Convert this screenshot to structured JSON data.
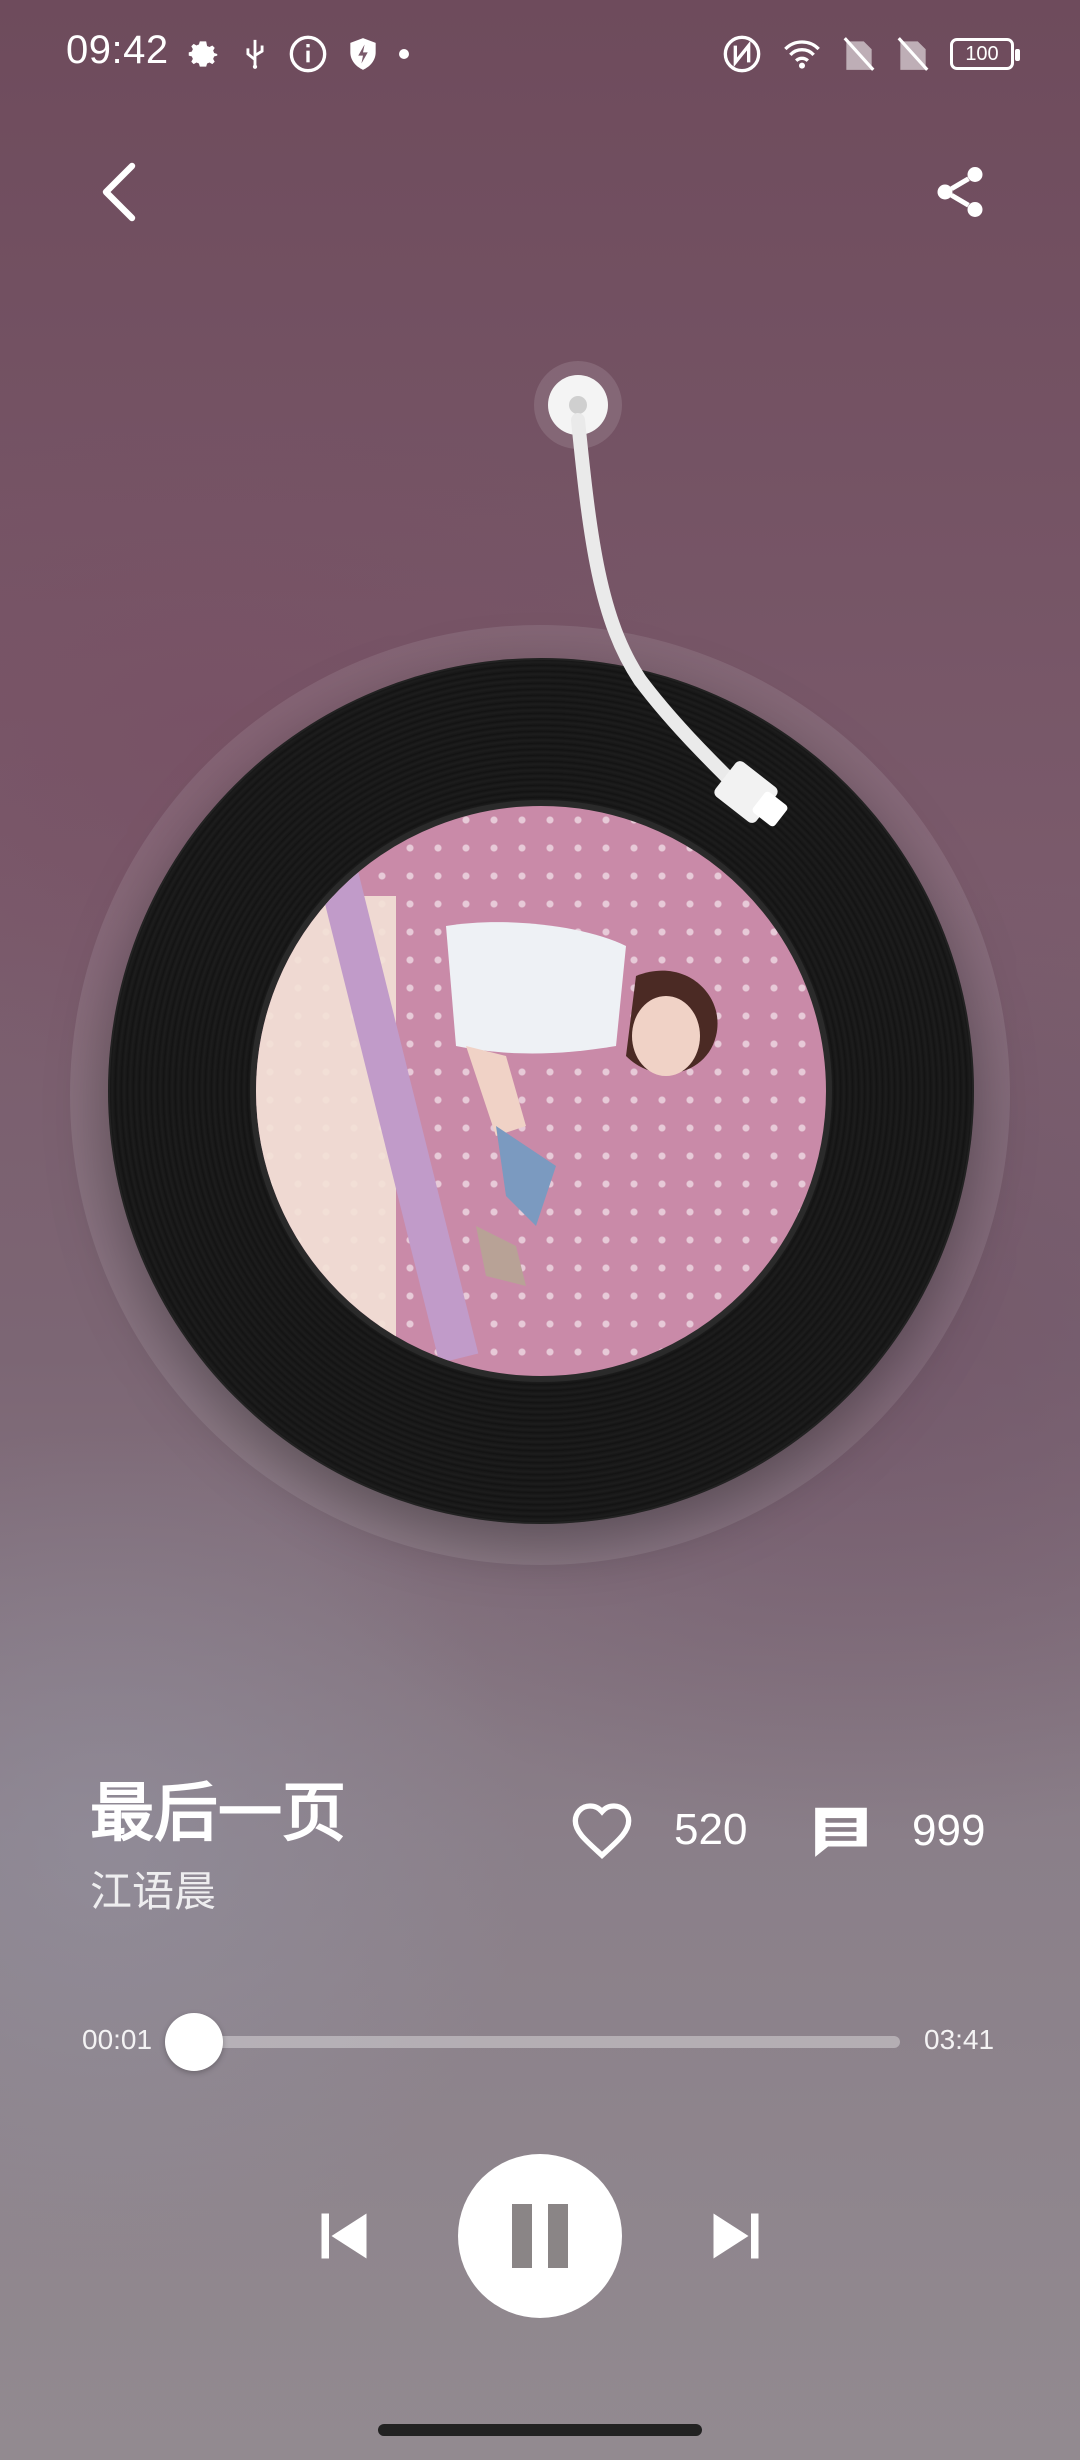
{
  "status_bar": {
    "time": "09:42",
    "battery": "100",
    "left_icons": [
      "settings-icon",
      "usb-icon",
      "info-icon",
      "shield-bolt-icon",
      "dot-icon"
    ],
    "right_icons": [
      "nfc-icon",
      "wifi-icon",
      "no-sim-icon",
      "no-sim-icon",
      "battery-icon"
    ]
  },
  "header": {
    "back_icon": "chevron-left-icon",
    "share_icon": "share-icon"
  },
  "song": {
    "title": "最后一页",
    "artist": "江语晨"
  },
  "stats": {
    "likes": "520",
    "comments": "999"
  },
  "progress": {
    "current": "00:01",
    "total": "03:41",
    "fraction": 0.005
  },
  "colors": {
    "accent": "#ffffff",
    "record": "#151515",
    "cover_pink": "#c98aa8"
  }
}
